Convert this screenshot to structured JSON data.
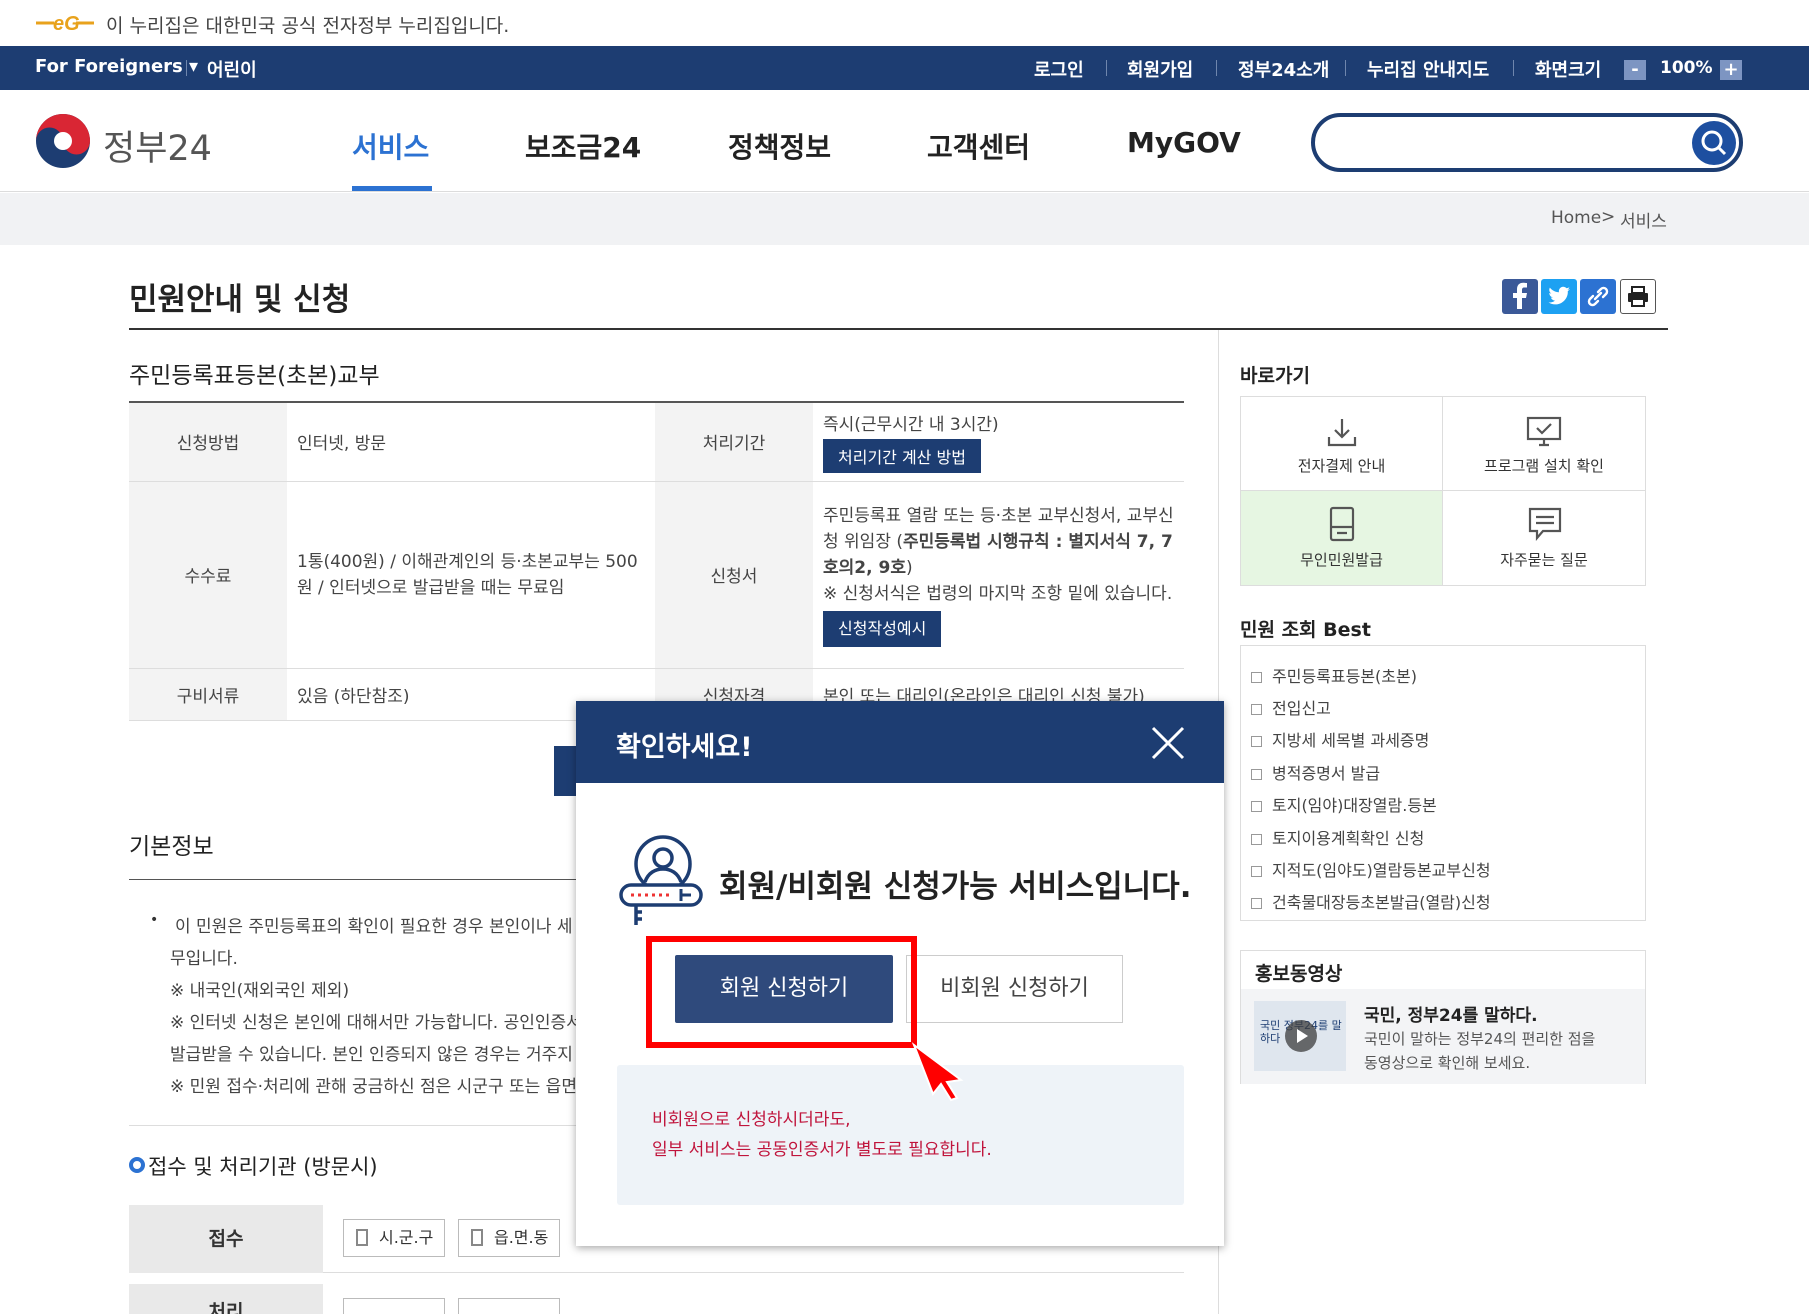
{
  "gov_banner": {
    "logo_text": "eG",
    "text": "이 누리집은 대한민국 공식 전자정부 누리집입니다."
  },
  "util_bar": {
    "left": [
      "For Foreigners ▾",
      "어린이"
    ],
    "right": [
      "로그인",
      "회원가입",
      "정부24소개",
      "누리집 안내지도",
      "화면크기"
    ],
    "zoom_minus": "-",
    "zoom_value": "100%",
    "zoom_plus": "+"
  },
  "header": {
    "logo_text": "정부24",
    "nav": [
      "서비스",
      "보조금24",
      "정책정보",
      "고객센터",
      "MyGOV"
    ],
    "search_placeholder": ""
  },
  "breadcrumb": {
    "home": "Home",
    "sep": ">",
    "current": "서비스"
  },
  "page_title": "민원안내 및 신청",
  "section_title": "주민등록표등본(초본)교부",
  "info_table": {
    "method_label": "신청방법",
    "method_value": "인터넷, 방문",
    "period_label": "처리기간",
    "period_value": "즉시(근무시간 내 3시간)",
    "period_button": "처리기간 계산 방법",
    "fee_label": "수수료",
    "fee_value": "1통(400원) / 이해관계인의 등·초본교부는 500원 / 인터넷으로 발급받을 때는 무료임",
    "form_label": "신청서",
    "form_value_1": "주민등록표 열람 또는 등·초본 교부신청서, 교부신청 위임장 (",
    "form_value_bold": "주민등록법 시행규칙 : 별지서식 7, 7호의2, 9호",
    "form_value_2": ")",
    "form_note": "※ 신청서식은 법령의 마지막 조항 밑에 있습니다.",
    "form_button": "신청작성예시",
    "docs_label": "구비서류",
    "docs_value": "있음 (하단참조)",
    "elig_label": "신청자격",
    "elig_value": "본인 또는 대리인(온라인은 대리인 신청 불가)"
  },
  "sidebar": {
    "quick_title": "바로가기",
    "quick_links": [
      "전자결제 안내",
      "프로그램 설치 확인",
      "무인민원발급",
      "자주묻는 질문"
    ],
    "best_title": "민원 조회 Best",
    "best_items": [
      "주민등록표등본(초본)",
      "전입신고",
      "지방세 세목별 과세증명",
      "병적증명서 발급",
      "토지(임야)대장열람.등본",
      "토지이용계획확인 신청",
      "지적도(임야도)열람등본교부신청",
      "건축물대장등초본발급(열람)신청"
    ],
    "promo_title": "홍보동영상",
    "promo_headline": "국민, 정부24를 말하다.",
    "promo_desc_1": "국민이 말하는 정부24의 편리한 점을",
    "promo_desc_2": "동영상으로 확인해 보세요.",
    "promo_thumb_text": "국민 정부24를 말하다"
  },
  "basic_info": {
    "title": "기본정보",
    "lines": [
      "이 민원은 주민등록표의 확인이 필요한 경우 본인이나 세",
      "무입니다.",
      "※ 내국인(재외국인 제외)",
      "※ 인터넷 신청은 본인에 대해서만 가능합니다. 공인인증서",
      "발급받을 수 있습니다. 본인 인증되지 않은 경우는 거주지",
      "※ 민원 접수·처리에 관해 궁금하신 점은 시군구 또는 읍면"
    ]
  },
  "office": {
    "title": "접수 및 처리기관 (방문시)",
    "receive_label": "접수",
    "process_label": "처리",
    "opt1": "시.군.구",
    "opt2": "읍.면.동"
  },
  "modal": {
    "title": "확인하세요!",
    "message": "회원/비회원 신청가능 서비스입니다.",
    "member_button": "회원 신청하기",
    "nonmember_button": "비회원 신청하기",
    "notice_1": "비회원으로 신청하시더라도,",
    "notice_2": "일부 서비스는 공동인증서가 별도로 필요합니다."
  },
  "colors": {
    "navy": "#1d3d72",
    "accent_blue": "#2c72d2",
    "highlight_red": "#ff0000",
    "notice_red": "#c0143c"
  }
}
